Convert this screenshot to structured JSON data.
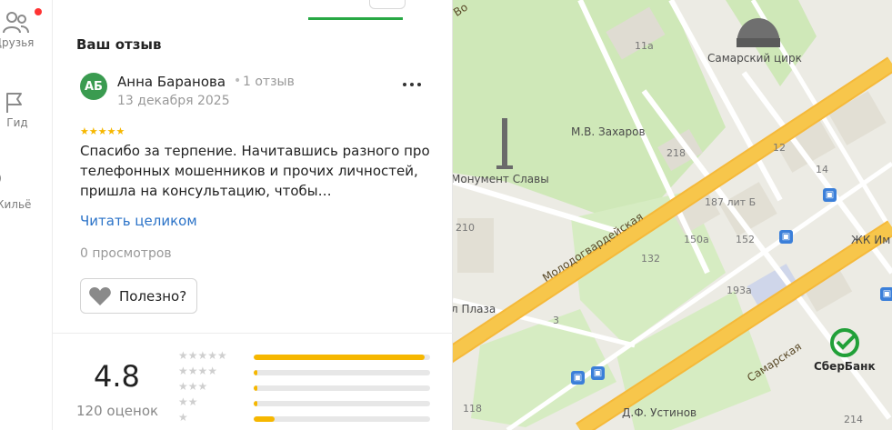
{
  "rail": {
    "items": [
      {
        "label": "Друзья",
        "icon": "friends-icon"
      },
      {
        "label": "Гид",
        "icon": "flag-icon"
      },
      {
        "label": "Жильё",
        "icon": "housing-icon"
      }
    ]
  },
  "review": {
    "section_title": "Ваш отзыв",
    "avatar_initials": "АБ",
    "author": "Анна Баранова",
    "author_review_count": "1 отзыв",
    "date": "13 декабря 2025",
    "stars": "★★★★★",
    "rating": 5,
    "text": "Спасибо за терпение. Начитавшись разного про телефонных мошенников и прочих личностей, пришла на консультацию, чтобы…",
    "read_more": "Читать целиком",
    "views": "0 просмотров",
    "useful_label": "Полезно?"
  },
  "summary": {
    "rating": "4.8",
    "ratings_count": "120 оценок",
    "distribution": [
      {
        "stars": "★★★★★",
        "share": 0.97
      },
      {
        "stars": "★★★★",
        "share": 0.02
      },
      {
        "stars": "★★★",
        "share": 0.01
      },
      {
        "stars": "★★",
        "share": 0.01
      },
      {
        "stars": "★",
        "share": 0.12
      }
    ]
  },
  "map": {
    "labels": {
      "circus": "Самарский цирк",
      "monument": "Монумент Славы",
      "zakharov": "М.В. Захаров",
      "ustinov": "Д.Ф. Устинов",
      "plaza": "л Плаза",
      "zhk": "ЖК Им",
      "sberbank": "СберБанк",
      "street_molodogvardeyskaya": "Молодогвардейская",
      "street_samarskaya": "Самарская",
      "street_top": "Во"
    },
    "numbers": {
      "n11a": "11а",
      "n218": "218",
      "n187": "187 лит Б",
      "n150a": "150а",
      "n152": "152",
      "n132": "132",
      "n210": "210",
      "n193a": "193а",
      "n3": "3",
      "n118": "118",
      "n12": "12",
      "n14": "14",
      "n214": "214"
    },
    "colors": {
      "major_road": "#f7c64b",
      "park": "#cfe8b8",
      "building": "#e2dfd4",
      "background": "#ecebe4"
    }
  }
}
